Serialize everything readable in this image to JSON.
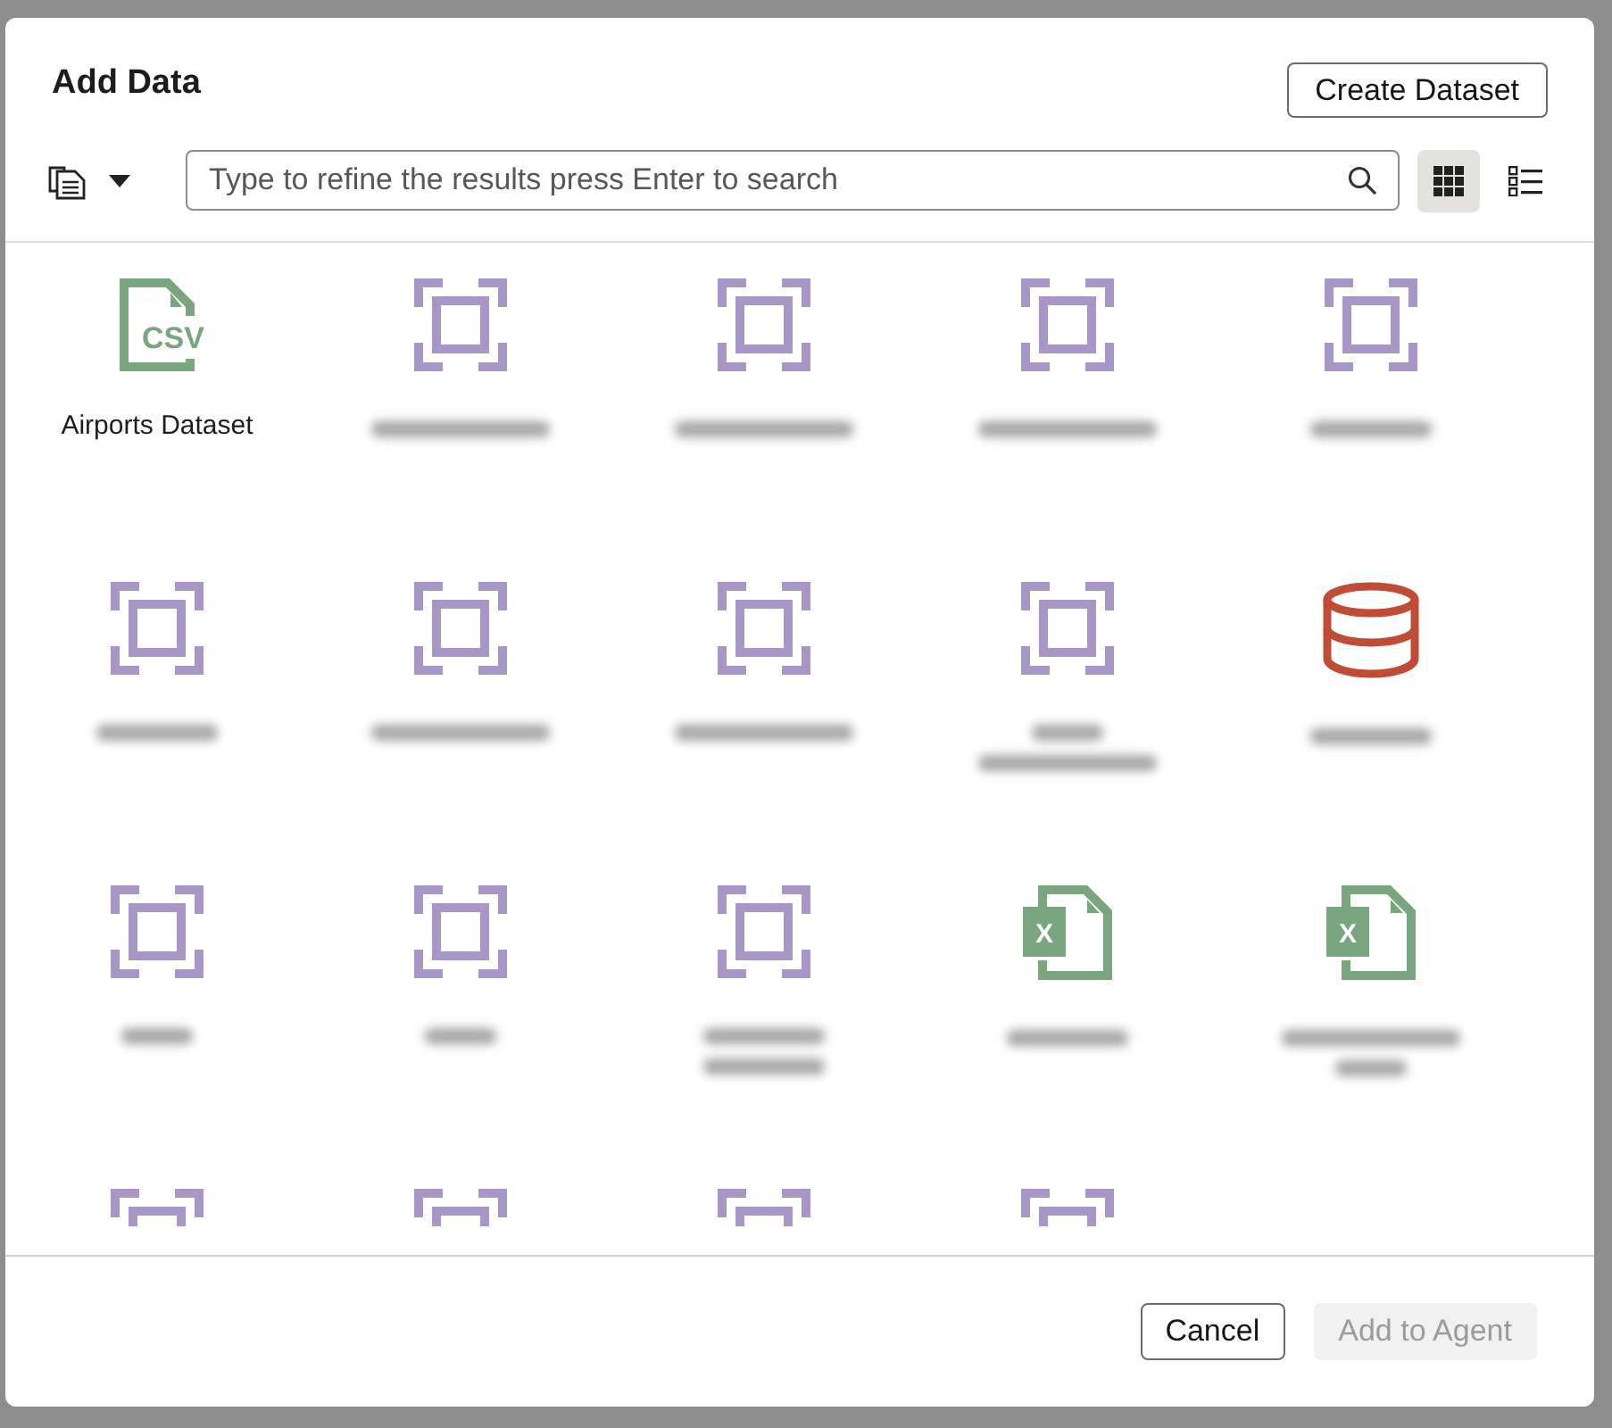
{
  "dialog": {
    "title": "Add Data",
    "create_button": "Create Dataset"
  },
  "toolbar": {
    "search": {
      "placeholder": "Type to refine the results press Enter to search"
    },
    "views": [
      {
        "kind": "grid",
        "selected": true
      },
      {
        "kind": "list",
        "selected": false
      }
    ]
  },
  "tiles": [
    {
      "kind": "csv",
      "icon_text": "CSV",
      "label": "Airports Dataset"
    },
    {
      "kind": "object",
      "blurred_lines": [
        {
          "kind": "long"
        }
      ]
    },
    {
      "kind": "object",
      "blurred_lines": [
        {
          "kind": "long"
        }
      ]
    },
    {
      "kind": "object",
      "blurred_lines": [
        {
          "kind": "long"
        }
      ]
    },
    {
      "kind": "object",
      "blurred_lines": [
        {
          "kind": "medium"
        }
      ]
    },
    {
      "kind": "object",
      "blurred_lines": [
        {
          "kind": "medium"
        }
      ]
    },
    {
      "kind": "object",
      "blurred_lines": [
        {
          "kind": "long"
        }
      ]
    },
    {
      "kind": "object",
      "blurred_lines": [
        {
          "kind": "long"
        }
      ]
    },
    {
      "kind": "object",
      "blurred_lines": [
        {
          "kind": "short"
        },
        {
          "kind": "long"
        }
      ]
    },
    {
      "kind": "database",
      "blurred_lines": [
        {
          "kind": "medium"
        }
      ]
    },
    {
      "kind": "object",
      "blurred_lines": [
        {
          "kind": "short"
        }
      ]
    },
    {
      "kind": "object",
      "blurred_lines": [
        {
          "kind": "short"
        }
      ]
    },
    {
      "kind": "object",
      "blurred_lines": [
        {
          "kind": "medium"
        },
        {
          "kind": "medium"
        }
      ]
    },
    {
      "kind": "excel",
      "icon_text": "X",
      "blurred_lines": [
        {
          "kind": "medium"
        }
      ]
    },
    {
      "kind": "excel",
      "icon_text": "X",
      "blurred_lines": [
        {
          "kind": "long"
        },
        {
          "kind": "short"
        }
      ]
    },
    {
      "kind": "object"
    },
    {
      "kind": "object"
    },
    {
      "kind": "object"
    },
    {
      "kind": "object"
    }
  ],
  "footer": {
    "buttons": [
      {
        "label": "Cancel",
        "disabled": false
      },
      {
        "label": "Add to Agent",
        "disabled": true
      }
    ]
  }
}
